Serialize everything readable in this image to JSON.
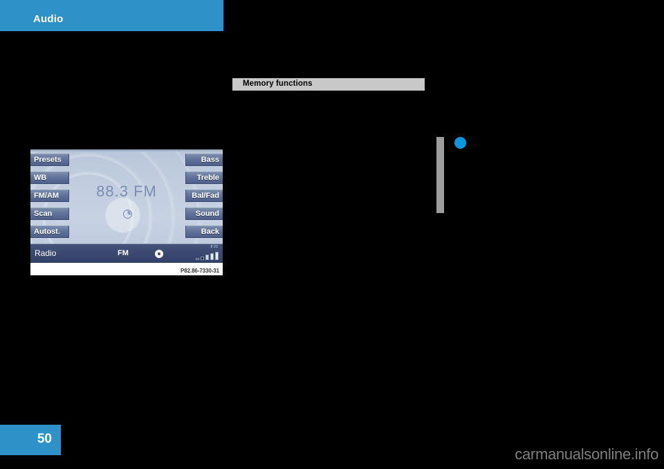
{
  "header": {
    "title": "Audio"
  },
  "section": {
    "heading": "Memory functions"
  },
  "marks": {
    "change_bar_color": "#9d9d9d",
    "dot_color": "#0b97e0"
  },
  "figure": {
    "caption": "P82.86-7330-31",
    "screen": {
      "station": "88.3 FM",
      "left_buttons": [
        {
          "label": "Presets"
        },
        {
          "label": "WB"
        },
        {
          "label": "FM/AM"
        },
        {
          "label": "Scan"
        },
        {
          "label": "Autost."
        }
      ],
      "right_buttons": [
        {
          "label": "Bass"
        },
        {
          "label": "Treble"
        },
        {
          "label": "Bal/Fad"
        },
        {
          "label": "Sound"
        },
        {
          "label": "Back"
        }
      ],
      "status": {
        "source": "Radio",
        "band": "FM",
        "clock": "8:33"
      }
    }
  },
  "footer": {
    "page_number": "50",
    "watermark": "carmanualsonline.info"
  },
  "colors": {
    "accent": "#2e92c8",
    "heading_bar": "#c8c8c8",
    "page_background": "#000000"
  }
}
